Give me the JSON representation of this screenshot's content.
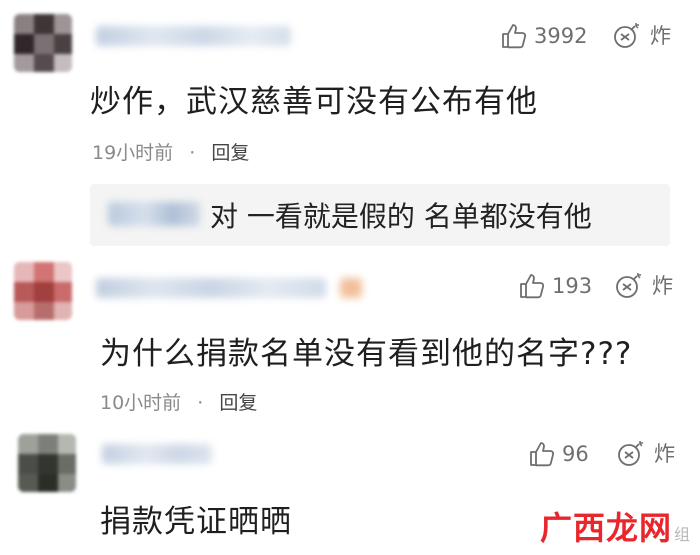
{
  "comments": [
    {
      "likes": "3992",
      "bomb_label": "炸",
      "text": "炒作，武汉慈善可没有公布有他",
      "time": "19小时前",
      "separator": "·",
      "reply_label": "回复",
      "reply_preview": "对 一看就是假的  名单都没有他"
    },
    {
      "likes": "193",
      "bomb_label": "炸",
      "text": "为什么捐款名单没有看到他的名字???",
      "time": "10小时前",
      "separator": "·",
      "reply_label": "回复"
    },
    {
      "likes": "96",
      "bomb_label": "炸",
      "text": "捐款凭证晒晒"
    }
  ],
  "watermark": {
    "brand": "广西龙网",
    "sub": "组"
  },
  "colors": {
    "meta_gray": "#8a8a8a",
    "icon_gray": "#6e6e6e",
    "watermark_red": "#e8262c",
    "reply_bg": "#f4f4f4"
  },
  "icons": [
    "thumbs-up-icon",
    "bomb-icon"
  ]
}
